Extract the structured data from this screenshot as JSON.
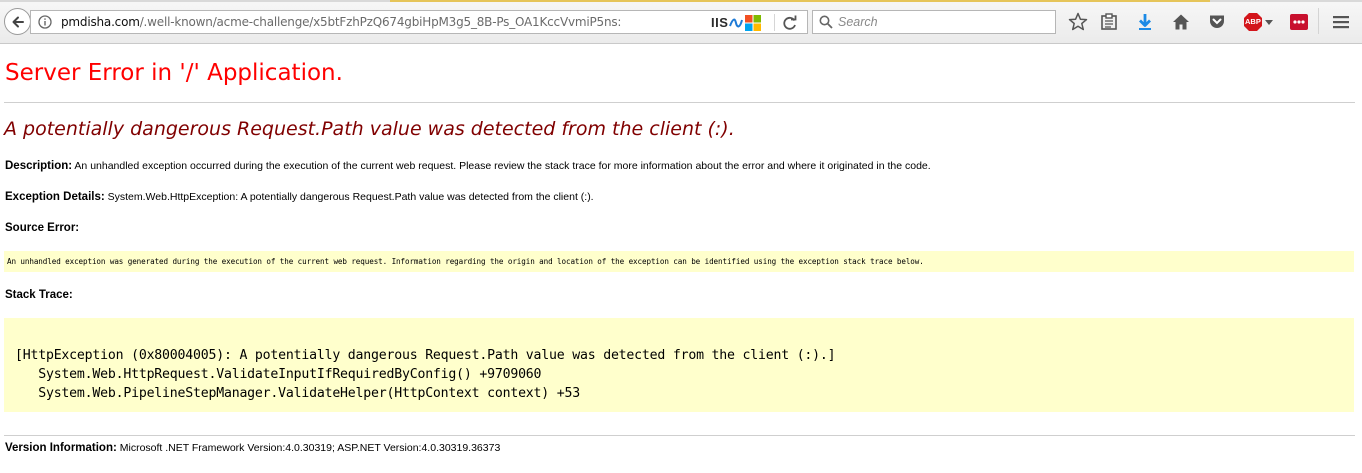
{
  "browser": {
    "url_host": "pmdisha.com",
    "url_path": "/.well-known/acme-challenge/x5btFzhPzQ674gbiHpM3g5_8B-Ps_OA1KccVvmiP5ns:",
    "server_badge": "IIS",
    "search_placeholder": "Search",
    "abp_badge": "ABP"
  },
  "page": {
    "title": "Server Error in '/' Application.",
    "subtitle": "A potentially dangerous Request.Path value was detected from the client (:).",
    "description_label": "Description:",
    "description_text": " An unhandled exception occurred during the execution of the current web request. Please review the stack trace for more information about the error and where it originated in the code.",
    "exception_label": "Exception Details:",
    "exception_text": " System.Web.HttpException: A potentially dangerous Request.Path value was detected from the client (:).",
    "source_error_heading": "Source Error:",
    "source_error_text": "An unhandled exception was generated during the execution of the current web request. Information regarding the origin and location of the exception can be identified using the exception stack trace below.",
    "stack_trace_heading": "Stack Trace:",
    "stack_lines": [
      "[HttpException (0x80004005): A potentially dangerous Request.Path value was detected from the client (:).]",
      "   System.Web.HttpRequest.ValidateInputIfRequiredByConfig() +9709060",
      "   System.Web.PipelineStepManager.ValidateHelper(HttpContext context) +53"
    ],
    "version_label": "Version Information:",
    "version_text": " Microsoft .NET Framework Version:4.0.30319; ASP.NET Version:4.0.30319.36373"
  },
  "colors": {
    "title_red": "#ff0000",
    "subtitle_maroon": "#800000",
    "code_bg": "#ffffcc",
    "download_blue": "#1b8ae6",
    "abp_red": "#d3151b"
  }
}
